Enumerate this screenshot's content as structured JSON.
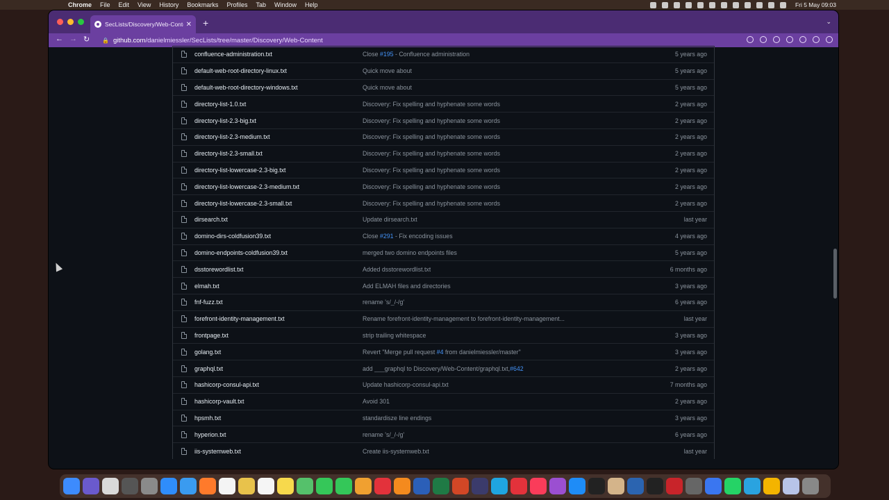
{
  "menubar": {
    "app": "Chrome",
    "menus": [
      "File",
      "Edit",
      "View",
      "History",
      "Bookmarks",
      "Profiles",
      "Tab",
      "Window",
      "Help"
    ],
    "clock": "Fri 5 May  09:03"
  },
  "browser": {
    "tab_title": "SecLists/Discovery/Web-Conte",
    "url_host": "github.com",
    "url_path": "/danielmiessler/SecLists/tree/master/Discovery/Web-Content"
  },
  "files": [
    {
      "name": "confluence-administration.txt",
      "commit_pre": "Close ",
      "pr": "#195",
      "commit_post": " - Confluence administration",
      "age": "5 years ago"
    },
    {
      "name": "default-web-root-directory-linux.txt",
      "commit_pre": "Quick move about",
      "pr": "",
      "commit_post": "",
      "age": "5 years ago"
    },
    {
      "name": "default-web-root-directory-windows.txt",
      "commit_pre": "Quick move about",
      "pr": "",
      "commit_post": "",
      "age": "5 years ago"
    },
    {
      "name": "directory-list-1.0.txt",
      "commit_pre": "Discovery: Fix spelling and hyphenate some words",
      "pr": "",
      "commit_post": "",
      "age": "2 years ago"
    },
    {
      "name": "directory-list-2.3-big.txt",
      "commit_pre": "Discovery: Fix spelling and hyphenate some words",
      "pr": "",
      "commit_post": "",
      "age": "2 years ago"
    },
    {
      "name": "directory-list-2.3-medium.txt",
      "commit_pre": "Discovery: Fix spelling and hyphenate some words",
      "pr": "",
      "commit_post": "",
      "age": "2 years ago"
    },
    {
      "name": "directory-list-2.3-small.txt",
      "commit_pre": "Discovery: Fix spelling and hyphenate some words",
      "pr": "",
      "commit_post": "",
      "age": "2 years ago"
    },
    {
      "name": "directory-list-lowercase-2.3-big.txt",
      "commit_pre": "Discovery: Fix spelling and hyphenate some words",
      "pr": "",
      "commit_post": "",
      "age": "2 years ago"
    },
    {
      "name": "directory-list-lowercase-2.3-medium.txt",
      "commit_pre": "Discovery: Fix spelling and hyphenate some words",
      "pr": "",
      "commit_post": "",
      "age": "2 years ago"
    },
    {
      "name": "directory-list-lowercase-2.3-small.txt",
      "commit_pre": "Discovery: Fix spelling and hyphenate some words",
      "pr": "",
      "commit_post": "",
      "age": "2 years ago"
    },
    {
      "name": "dirsearch.txt",
      "commit_pre": "Update dirsearch.txt",
      "pr": "",
      "commit_post": "",
      "age": "last year"
    },
    {
      "name": "domino-dirs-coldfusion39.txt",
      "commit_pre": "Close ",
      "pr": "#291",
      "commit_post": " - Fix encoding issues",
      "age": "4 years ago"
    },
    {
      "name": "domino-endpoints-coldfusion39.txt",
      "commit_pre": "merged two domino endpoints files",
      "pr": "",
      "commit_post": "",
      "age": "5 years ago"
    },
    {
      "name": "dsstorewordlist.txt",
      "commit_pre": "Added dsstorewordlist.txt",
      "pr": "",
      "commit_post": "",
      "age": "6 months ago"
    },
    {
      "name": "elmah.txt",
      "commit_pre": "Add ELMAH files and directories",
      "pr": "",
      "commit_post": "",
      "age": "3 years ago"
    },
    {
      "name": "fnf-fuzz.txt",
      "commit_pre": "rename 's/_/-/g'",
      "pr": "",
      "commit_post": "",
      "age": "6 years ago"
    },
    {
      "name": "forefront-identity-management.txt",
      "commit_pre": "Rename forefront-identity-management to forefront-identity-management...",
      "pr": "",
      "commit_post": "",
      "age": "last year"
    },
    {
      "name": "frontpage.txt",
      "commit_pre": "strip trailing whitespace",
      "pr": "",
      "commit_post": "",
      "age": "3 years ago"
    },
    {
      "name": "golang.txt",
      "commit_pre": "Revert \"Merge pull request ",
      "pr": "#4",
      "commit_post": " from danielmiessler/master\"",
      "age": "3 years ago"
    },
    {
      "name": "graphql.txt",
      "commit_pre": "add ___graphql to Discovery/Web-Content/graphql.txt,",
      "pr": "#642",
      "commit_post": "",
      "age": "2 years ago"
    },
    {
      "name": "hashicorp-consul-api.txt",
      "commit_pre": "Update hashicorp-consul-api.txt",
      "pr": "",
      "commit_post": "",
      "age": "7 months ago"
    },
    {
      "name": "hashicorp-vault.txt",
      "commit_pre": "Avoid 301",
      "pr": "",
      "commit_post": "",
      "age": "2 years ago"
    },
    {
      "name": "hpsmh.txt",
      "commit_pre": "standardisze line endings",
      "pr": "",
      "commit_post": "",
      "age": "3 years ago"
    },
    {
      "name": "hyperion.txt",
      "commit_pre": "rename 's/_/-/g'",
      "pr": "",
      "commit_post": "",
      "age": "6 years ago"
    },
    {
      "name": "iis-systemweb.txt",
      "commit_pre": "Create iis-systemweb.txt",
      "pr": "",
      "commit_post": "",
      "age": "last year"
    }
  ],
  "colors": {
    "tab_bar": "#4b2c73",
    "toolbar": "#6b3fa0",
    "page_bg": "#0d1117",
    "link": "#4493f8"
  },
  "dock_apps": [
    "finder-icon",
    "siri-icon",
    "launchpad-icon",
    "mission-control-icon",
    "settings-icon",
    "safari-icon",
    "mail-icon",
    "firefox-icon",
    "calendar-icon",
    "notes-icon",
    "reminders-icon",
    "stickies-icon",
    "maps-icon",
    "messages-icon",
    "facetime-icon",
    "photos-icon",
    "news-icon",
    "books-icon",
    "word-icon",
    "excel-icon",
    "powerpoint-icon",
    "bbedit-icon",
    "skype-icon",
    "news-icon-2",
    "music-icon",
    "podcasts-icon",
    "appstore-icon",
    "tv-icon",
    "preview-icon",
    "virtualbox-icon",
    "terminal-icon",
    "filezilla-icon",
    "calculator-icon",
    "signal-icon",
    "whatsapp-icon",
    "telegram-icon",
    "chrome-icon",
    "finder-window-icon",
    "trash-icon"
  ]
}
